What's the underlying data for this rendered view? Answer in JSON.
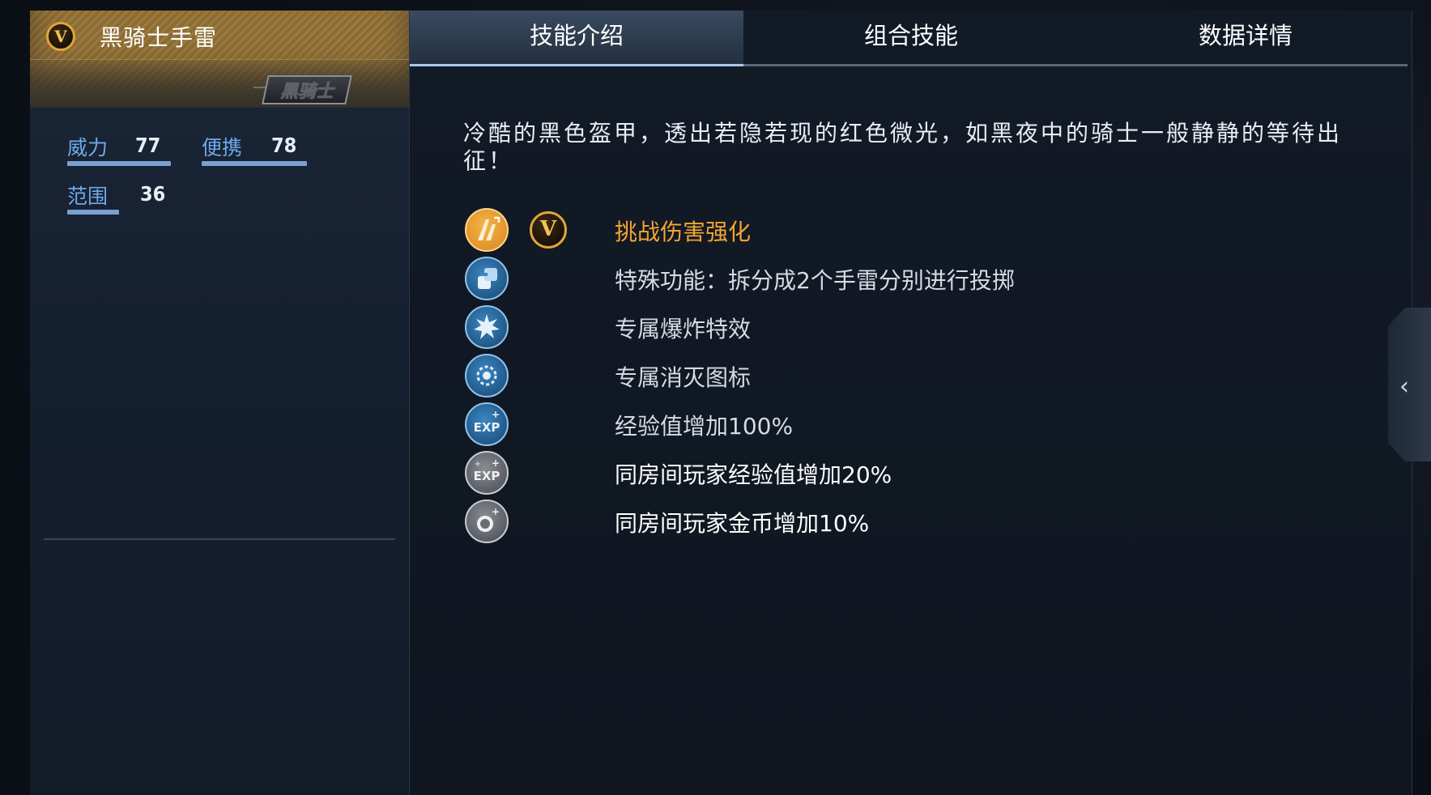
{
  "weapon": {
    "name": "黑骑士手雷",
    "tier_tag": "黑骑士",
    "badge_letter": "V"
  },
  "stats": [
    {
      "label": "威力",
      "value": "77"
    },
    {
      "label": "便携",
      "value": "78"
    },
    {
      "label": "范围",
      "value": "36"
    }
  ],
  "tabs": [
    {
      "label": "技能介绍",
      "active": true
    },
    {
      "label": "组合技能",
      "active": false
    },
    {
      "label": "数据详情",
      "active": false
    }
  ],
  "description": "冷酷的黑色盔甲，透出若隐若现的红色微光，如黑夜中的骑士一般静静的等待出征！",
  "skills": [
    {
      "icon": "orange-attack-boost-icon",
      "color": "#f2a531",
      "text": "挑战伤害强化"
    },
    {
      "icon": "grenade-split-icon",
      "color": "#d5dbe3",
      "text": "特殊功能：拆分成2个手雷分别进行投掷"
    },
    {
      "icon": "explosion-effect-icon",
      "color": "#d5dbe3",
      "text": "专属爆炸特效"
    },
    {
      "icon": "kill-icon-badge-icon",
      "color": "#d5dbe3",
      "text": "专属消灭图标"
    },
    {
      "icon": "exp-plus-icon",
      "color": "#d5dbe3",
      "text": "经验值增加100%"
    },
    {
      "icon": "room-exp-plus-icon",
      "color": "#ffffff",
      "text": "同房间玩家经验值增加20%"
    },
    {
      "icon": "room-coin-plus-icon",
      "color": "#ffffff",
      "text": "同房间玩家金币增加10%"
    }
  ]
}
